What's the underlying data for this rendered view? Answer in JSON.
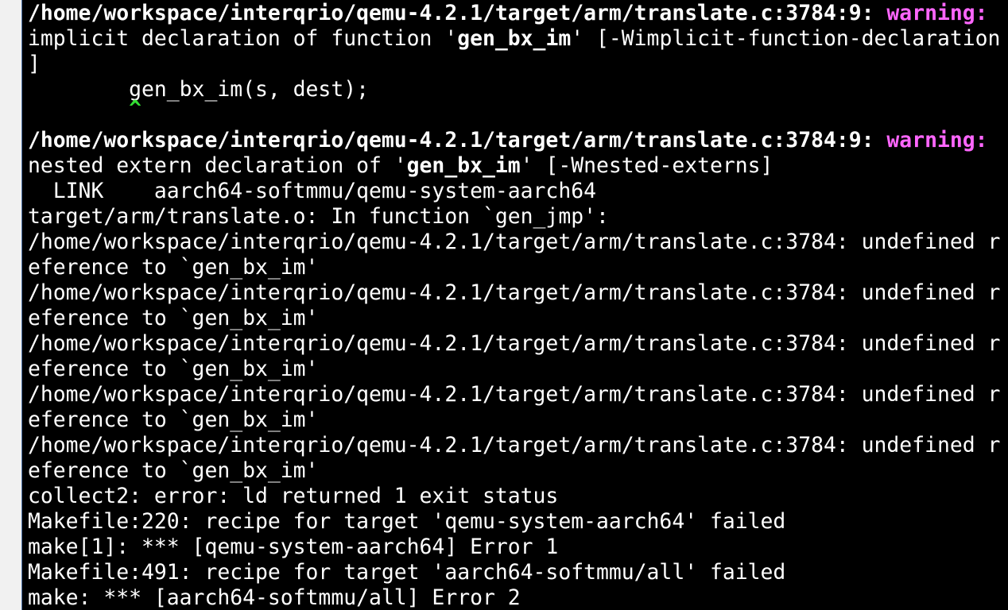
{
  "terminal": {
    "w1_path": "/home/workspace/interqrio/qemu-4.2.1/target/arm/translate.c:3784:9: ",
    "w1_label": "warning:",
    "w1_msg_pre": "implicit declaration of function '",
    "w1_msg_fn": "gen_bx_im",
    "w1_msg_post": "' [-Wimplicit-function-declaration",
    "w1_msg_tail": "]",
    "code_line": "        gen_bx_im(s, dest);",
    "caret_line": "        ^",
    "w2_path": "/home/workspace/interqrio/qemu-4.2.1/target/arm/translate.c:3784:9: ",
    "w2_label": "warning:",
    "w2_msg_pre": "nested extern declaration of '",
    "w2_msg_fn": "gen_bx_im",
    "w2_msg_post": "' [-Wnested-externs]",
    "link_line": "  LINK    aarch64-softmmu/qemu-system-aarch64",
    "in_function": "target/arm/translate.o: In function `gen_jmp':",
    "undef_a": "/home/workspace/interqrio/qemu-4.2.1/target/arm/translate.c:3784: undefined r",
    "undef_b": "eference to `gen_bx_im'",
    "collect2": "collect2: error: ld returned 1 exit status",
    "make1": "Makefile:220: recipe for target 'qemu-system-aarch64' failed",
    "make2": "make[1]: *** [qemu-system-aarch64] Error 1",
    "make3": "Makefile:491: recipe for target 'aarch64-softmmu/all' failed",
    "make4": "make: *** [aarch64-softmmu/all] Error 2"
  }
}
